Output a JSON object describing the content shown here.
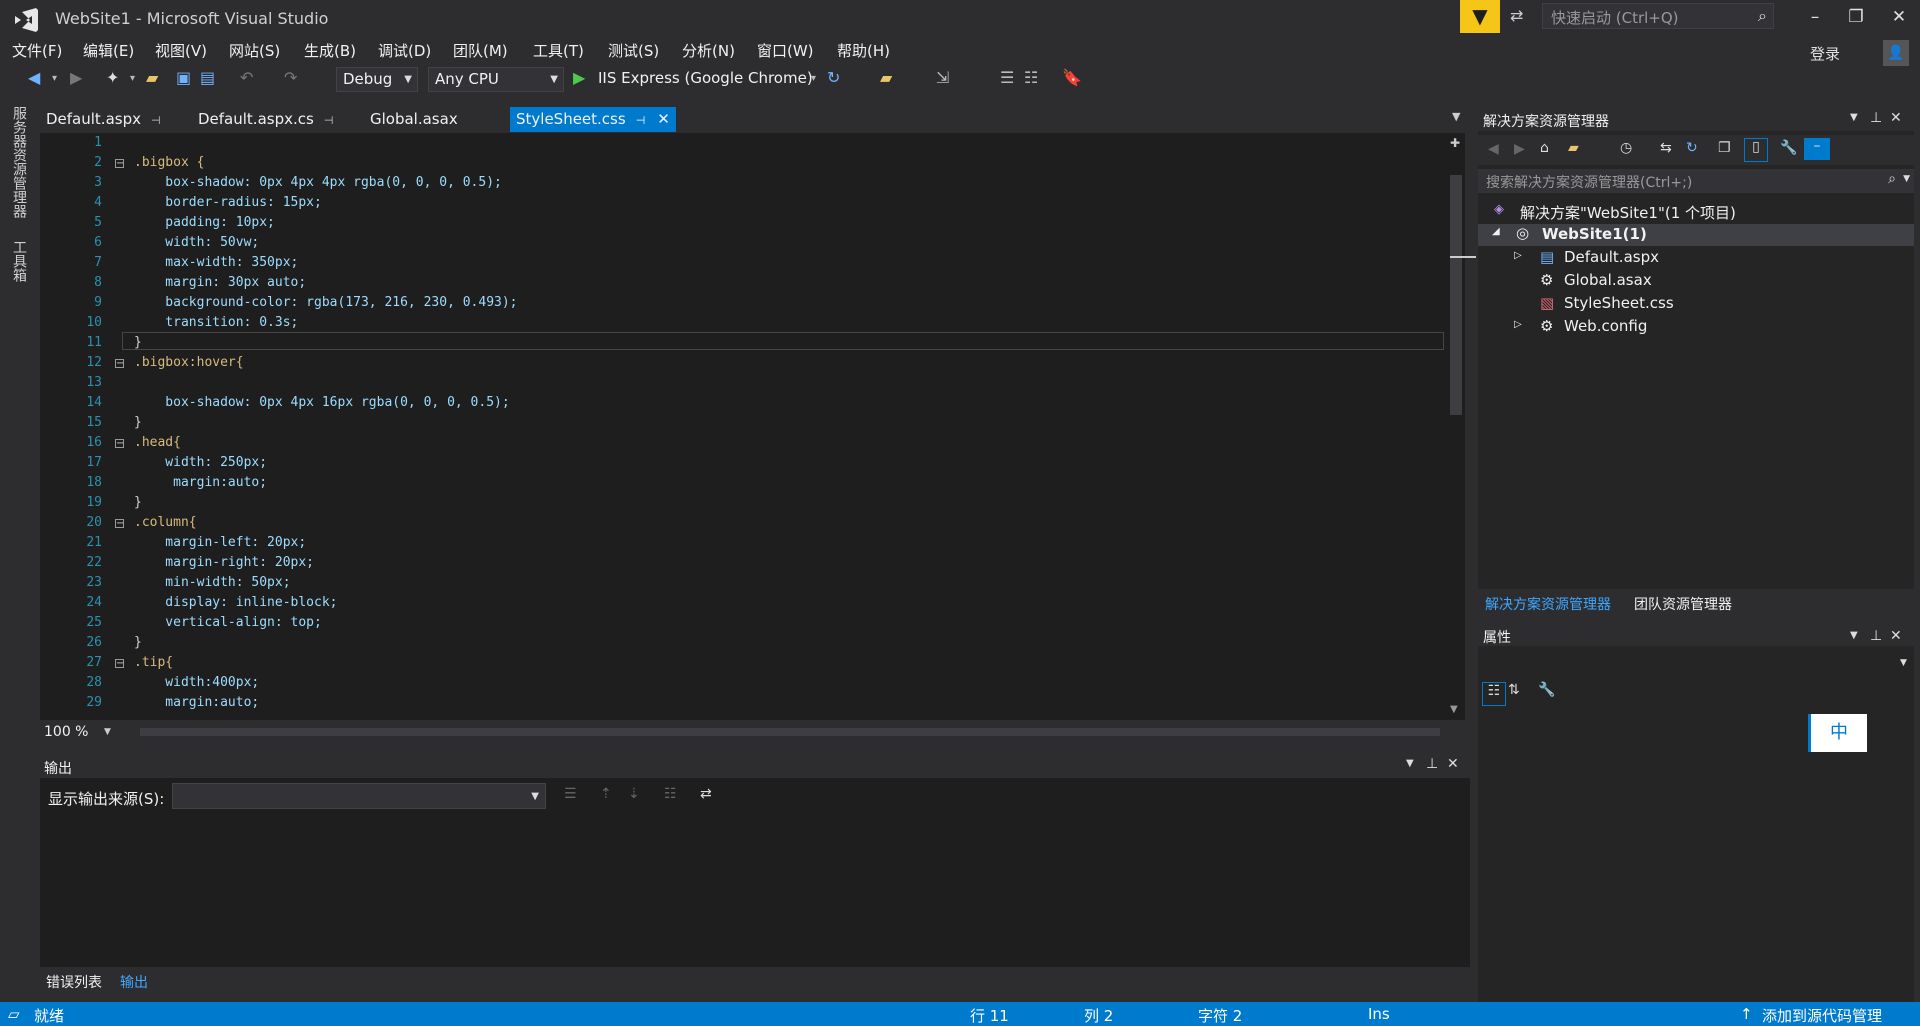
{
  "window": {
    "title": "WebSite1 - Microsoft Visual Studio",
    "quick_launch_placeholder": "快速启动 (Ctrl+Q)",
    "login": "登录"
  },
  "menu": [
    "文件(F)",
    "编辑(E)",
    "视图(V)",
    "网站(S)",
    "生成(B)",
    "调试(D)",
    "团队(M)",
    "工具(T)",
    "测试(S)",
    "分析(N)",
    "窗口(W)",
    "帮助(H)"
  ],
  "toolbar": {
    "config": "Debug",
    "platform": "Any CPU",
    "run_target": "IIS Express (Google Chrome)"
  },
  "left_strip": [
    "服务器资源管理器",
    "工具箱"
  ],
  "tabs": [
    "Default.aspx",
    "Default.aspx.cs",
    "Global.asax",
    "StyleSheet.css"
  ],
  "editor": {
    "zoom": "100 %",
    "lines": [
      {
        "n": "1",
        "t": ""
      },
      {
        "n": "2",
        "t": ".bigbox {"
      },
      {
        "n": "3",
        "t": "    box-shadow: 0px 4px 4px rgba(0, 0, 0, 0.5);"
      },
      {
        "n": "4",
        "t": "    border-radius: 15px;"
      },
      {
        "n": "5",
        "t": "    padding: 10px;"
      },
      {
        "n": "6",
        "t": "    width: 50vw;"
      },
      {
        "n": "7",
        "t": "    max-width: 350px;"
      },
      {
        "n": "8",
        "t": "    margin: 30px auto;"
      },
      {
        "n": "9",
        "t": "    background-color: rgba(173, 216, 230, 0.493);"
      },
      {
        "n": "10",
        "t": "    transition: 0.3s;"
      },
      {
        "n": "11",
        "t": "}"
      },
      {
        "n": "12",
        "t": ".bigbox:hover{"
      },
      {
        "n": "13",
        "t": ""
      },
      {
        "n": "14",
        "t": "    box-shadow: 0px 4px 16px rgba(0, 0, 0, 0.5);"
      },
      {
        "n": "15",
        "t": "}"
      },
      {
        "n": "16",
        "t": ".head{"
      },
      {
        "n": "17",
        "t": "    width: 250px;"
      },
      {
        "n": "18",
        "t": "     margin:auto;"
      },
      {
        "n": "19",
        "t": "}"
      },
      {
        "n": "20",
        "t": ".column{"
      },
      {
        "n": "21",
        "t": "    margin-left: 20px;"
      },
      {
        "n": "22",
        "t": "    margin-right: 20px;"
      },
      {
        "n": "23",
        "t": "    min-width: 50px;"
      },
      {
        "n": "24",
        "t": "    display: inline-block;"
      },
      {
        "n": "25",
        "t": "    vertical-align: top;"
      },
      {
        "n": "26",
        "t": "}"
      },
      {
        "n": "27",
        "t": ".tip{"
      },
      {
        "n": "28",
        "t": "    width:400px;"
      },
      {
        "n": "29",
        "t": "    margin:auto;"
      }
    ]
  },
  "output": {
    "title": "输出",
    "source_label": "显示输出来源(S):",
    "source_value": ""
  },
  "bottom_tabs": [
    "错误列表",
    "输出"
  ],
  "solution_explorer": {
    "title": "解决方案资源管理器",
    "search_placeholder": "搜索解决方案资源管理器(Ctrl+;)",
    "solution": "解决方案\"WebSite1\"(1 个项目)",
    "project": "WebSite1(1)",
    "items": [
      "Default.aspx",
      "Global.asax",
      "StyleSheet.css",
      "Web.config"
    ],
    "tabs": [
      "解决方案资源管理器",
      "团队资源管理器"
    ]
  },
  "properties": {
    "title": "属性",
    "ime": "中"
  },
  "status": {
    "ready": "就绪",
    "line": "行 11",
    "col": "列 2",
    "char": "字符 2",
    "mode": "Ins",
    "source_control": "添加到源代码管理"
  },
  "colors": {
    "accent": "#007acc",
    "background": "#2d2d30",
    "editor": "#1e1e1e",
    "selector": "#d7ba7d",
    "property": "#9cdcfe",
    "value": "#ce9178",
    "line_number": "#2b91af"
  }
}
